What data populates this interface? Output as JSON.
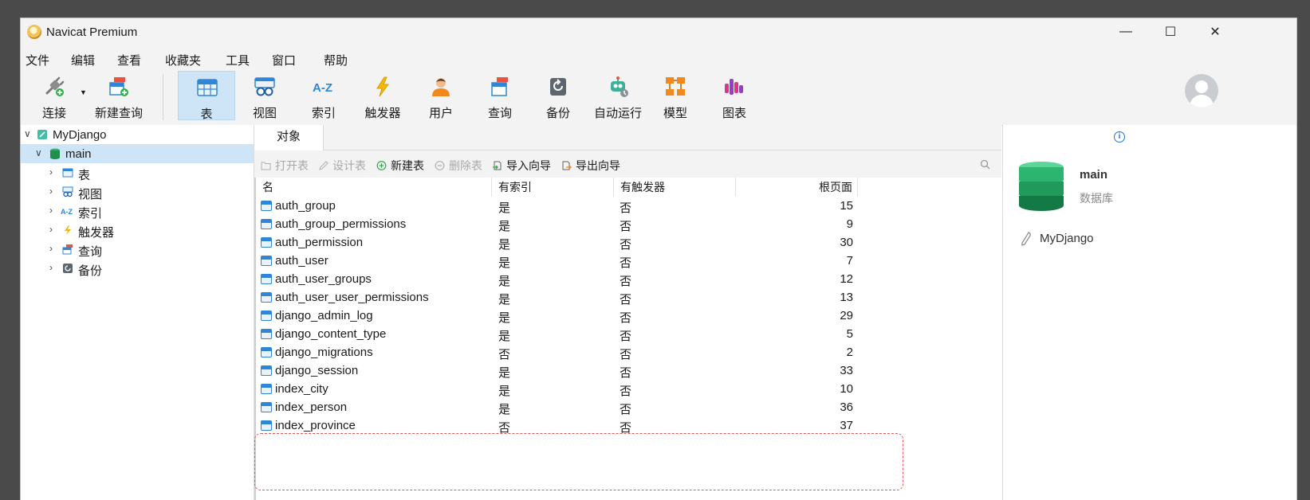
{
  "app": {
    "title": "Navicat Premium"
  },
  "window_controls": {
    "minimize": "—",
    "maximize": "☐",
    "close": "✕"
  },
  "menu": [
    "文件",
    "编辑",
    "查看",
    "收藏夹",
    "工具",
    "窗口",
    "帮助"
  ],
  "toolbar": {
    "connect": "连接",
    "new_query": "新建查询",
    "table": "表",
    "view": "视图",
    "index": "索引",
    "trigger": "触发器",
    "user": "用户",
    "query": "查询",
    "backup": "备份",
    "automation": "自动运行",
    "model": "模型",
    "chart": "图表"
  },
  "tree": {
    "connection": "MyDjango",
    "database": "main",
    "children": [
      "表",
      "视图",
      "索引",
      "触发器",
      "查询",
      "备份"
    ]
  },
  "tabs": {
    "objects": "对象"
  },
  "object_toolbar": {
    "open_table": "打开表",
    "design_table": "设计表",
    "new_table": "新建表",
    "delete_table": "删除表",
    "import_wizard": "导入向导",
    "export_wizard": "导出向导"
  },
  "grid": {
    "headers": [
      "名",
      "有索引",
      "有触发器",
      "根页面"
    ],
    "rows": [
      [
        "auth_group",
        "是",
        "否",
        "15"
      ],
      [
        "auth_group_permissions",
        "是",
        "否",
        "9"
      ],
      [
        "auth_permission",
        "是",
        "否",
        "30"
      ],
      [
        "auth_user",
        "是",
        "否",
        "7"
      ],
      [
        "auth_user_groups",
        "是",
        "否",
        "12"
      ],
      [
        "auth_user_user_permissions",
        "是",
        "否",
        "13"
      ],
      [
        "django_admin_log",
        "是",
        "否",
        "29"
      ],
      [
        "django_content_type",
        "是",
        "否",
        "5"
      ],
      [
        "django_migrations",
        "否",
        "否",
        "2"
      ],
      [
        "django_session",
        "是",
        "否",
        "33"
      ],
      [
        "index_city",
        "是",
        "否",
        "10"
      ],
      [
        "index_person",
        "是",
        "否",
        "36"
      ],
      [
        "index_province",
        "否",
        "否",
        "37"
      ]
    ]
  },
  "info_panel": {
    "info_icon": "i",
    "name": "main",
    "type": "数据库",
    "connection": "MyDjango"
  },
  "colors": {
    "accent": "#1e73d1",
    "selection": "#cde5f7",
    "highlight_border": "#e05a5a"
  }
}
